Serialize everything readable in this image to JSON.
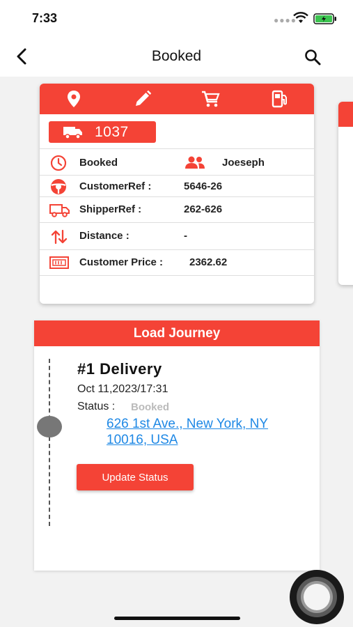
{
  "status_bar": {
    "time": "7:33"
  },
  "nav": {
    "title": "Booked"
  },
  "load_card": {
    "load_number": "1037",
    "rows": {
      "status": "Booked",
      "carrier": "Joeseph",
      "customer_ref_label": "CustomerRef :",
      "customer_ref_value": "5646-26",
      "shipper_ref_label": "ShipperRef :",
      "shipper_ref_value": "262-626",
      "distance_label": "Distance :",
      "distance_value": "-",
      "customer_price_label": "Customer Price :",
      "customer_price_value": "2362.62"
    }
  },
  "journey": {
    "header": "Load Journey",
    "stop": {
      "title": "#1  Delivery",
      "datetime": "Oct 11,2023/17:31",
      "status_label": "Status :",
      "status_value": "Booked",
      "address": "626 1st Ave., New York, NY 10016, USA",
      "update_button": "Update Status"
    }
  },
  "colors": {
    "accent": "#f44336",
    "link": "#1e88e5"
  }
}
